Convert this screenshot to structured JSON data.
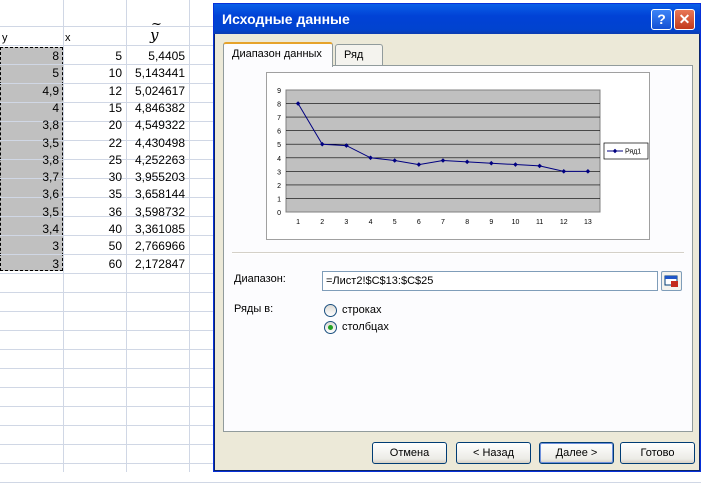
{
  "sheet": {
    "headers": {
      "y": "y",
      "x": "x",
      "yhat": "y",
      "yhat_tilde": "~"
    },
    "rows": [
      {
        "y": "8",
        "x": "5",
        "yhat": "5,4405"
      },
      {
        "y": "5",
        "x": "10",
        "yhat": "5,143441"
      },
      {
        "y": "4,9",
        "x": "12",
        "yhat": "5,024617"
      },
      {
        "y": "4",
        "x": "15",
        "yhat": "4,846382"
      },
      {
        "y": "3,8",
        "x": "20",
        "yhat": "4,549322"
      },
      {
        "y": "3,5",
        "x": "22",
        "yhat": "4,430498"
      },
      {
        "y": "3,8",
        "x": "25",
        "yhat": "4,252263"
      },
      {
        "y": "3,7",
        "x": "30",
        "yhat": "3,955203"
      },
      {
        "y": "3,6",
        "x": "35",
        "yhat": "3,658144"
      },
      {
        "y": "3,5",
        "x": "36",
        "yhat": "3,598732"
      },
      {
        "y": "3,4",
        "x": "40",
        "yhat": "3,361085"
      },
      {
        "y": "3",
        "x": "50",
        "yhat": "2,766966"
      },
      {
        "y": "3",
        "x": "60",
        "yhat": "2,172847"
      }
    ]
  },
  "dialog": {
    "title": "Исходные данные",
    "help_glyph": "?",
    "close_glyph": "✕",
    "tabs": [
      {
        "label": "Диапазон данных",
        "active": true
      },
      {
        "label": "Ряд",
        "active": false
      }
    ],
    "range_label": "Диапазон:",
    "range_value": "=Лист2!$C$13:$C$25",
    "series_in_label": "Ряды в:",
    "radio_rows_label": "строках",
    "radio_cols_label": "столбцах",
    "radio_selected": "cols",
    "buttons": {
      "cancel": "Отмена",
      "back": "< Назад",
      "next": "Далее >",
      "finish": "Готово"
    }
  },
  "chart_data": {
    "type": "line",
    "categories": [
      "1",
      "2",
      "3",
      "4",
      "5",
      "6",
      "7",
      "8",
      "9",
      "10",
      "11",
      "12",
      "13"
    ],
    "series": [
      {
        "name": "Ряд1",
        "values": [
          8,
          5,
          4.9,
          4,
          3.8,
          3.5,
          3.8,
          3.7,
          3.6,
          3.5,
          3.4,
          3,
          3
        ]
      }
    ],
    "yticks": [
      "0",
      "1",
      "2",
      "3",
      "4",
      "5",
      "6",
      "7",
      "8",
      "9"
    ],
    "ylim": [
      0,
      9
    ],
    "grid": true,
    "legend_position": "right",
    "colors": {
      "plot_bg": "#c0c0c0",
      "line": "#000080"
    }
  }
}
